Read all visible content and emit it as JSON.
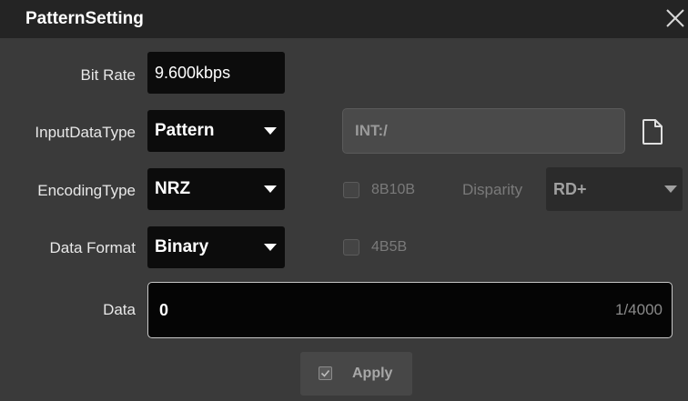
{
  "dialog": {
    "title": "PatternSetting",
    "close_icon": "close-icon"
  },
  "form": {
    "bit_rate": {
      "label": "Bit Rate",
      "value": "9.600kbps"
    },
    "input_data_type": {
      "label": "InputDataType",
      "value": "Pattern"
    },
    "file_path": {
      "value": "INT:/",
      "icon": "document-icon"
    },
    "encoding_type": {
      "label": "EncodingType",
      "value": "NRZ"
    },
    "option_8b10b": {
      "label": "8B10B",
      "checked": false
    },
    "disparity": {
      "label": "Disparity",
      "value": "RD+"
    },
    "data_format": {
      "label": "Data Format",
      "value": "Binary"
    },
    "option_4b5b": {
      "label": "4B5B",
      "checked": false
    },
    "data": {
      "label": "Data",
      "value": "0",
      "counter": "1/4000"
    }
  },
  "apply": {
    "label": "Apply"
  },
  "colors": {
    "background": "#3a3a3a",
    "titlebar": "#242424",
    "field": "#0c0c0c",
    "text": "#ffffff",
    "disabled_text": "#7a7a7a"
  }
}
